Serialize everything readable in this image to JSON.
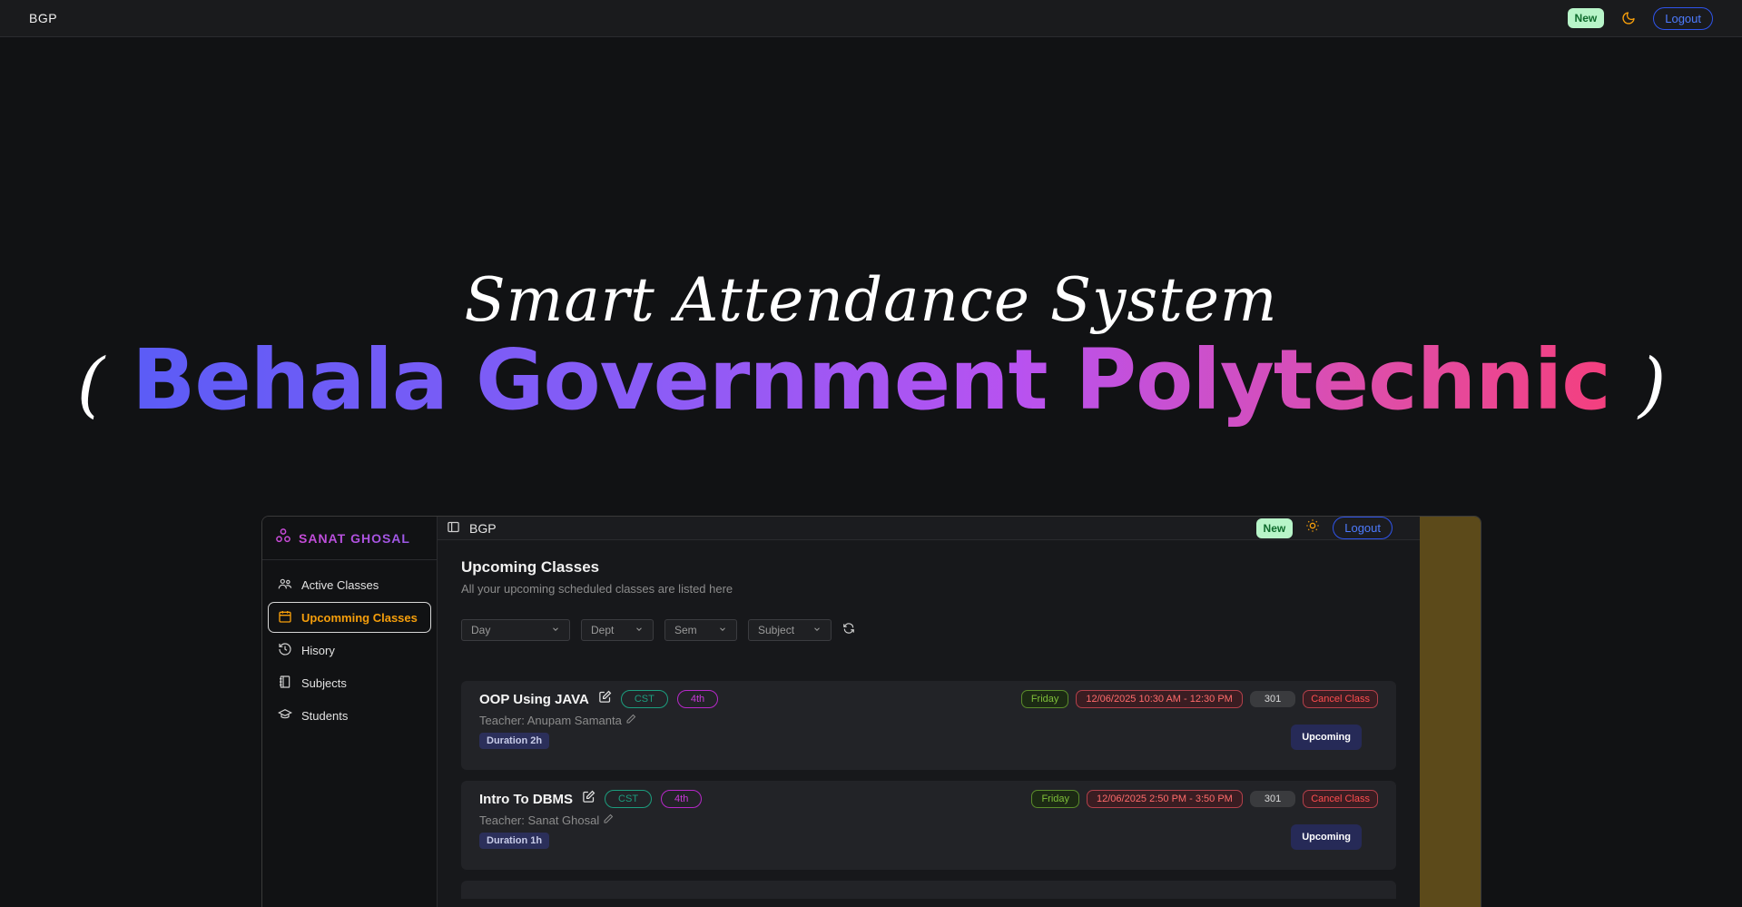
{
  "navbar": {
    "brand": "BGP",
    "new_badge": "New",
    "logout_label": "Logout"
  },
  "hero": {
    "subtitle": "Smart Attendance System",
    "bracket_open": "(",
    "title": "Behala Government Polytechnic",
    "bracket_close": ")"
  },
  "preview": {
    "user_name": "SANAT GHOSAL",
    "sidebar": {
      "items": [
        {
          "label": "Active Classes",
          "icon": "users-icon"
        },
        {
          "label": "Upcomming Classes",
          "icon": "calendar-icon"
        },
        {
          "label": "Hisory",
          "icon": "history-icon"
        },
        {
          "label": "Subjects",
          "icon": "book-icon"
        },
        {
          "label": "Students",
          "icon": "graduation-cap-icon"
        }
      ]
    },
    "topbar": {
      "brand": "BGP",
      "new_badge": "New",
      "logout_label": "Logout"
    },
    "page": {
      "title": "Upcoming Classes",
      "subtitle": "All your upcoming scheduled classes are listed here"
    },
    "filters": {
      "day": "Day",
      "dept": "Dept",
      "sem": "Sem",
      "subject": "Subject"
    },
    "classes": [
      {
        "title": "OOP Using JAVA",
        "dept": "CST",
        "sem": "4th",
        "day": "Friday",
        "datetime": "12/06/2025 10:30 AM - 12:30 PM",
        "room": "301",
        "cancel_label": "Cancel Class",
        "teacher": "Teacher: Anupam Samanta",
        "duration": "Duration 2h",
        "status": "Upcoming"
      },
      {
        "title": "Intro To DBMS",
        "dept": "CST",
        "sem": "4th",
        "day": "Friday",
        "datetime": "12/06/2025 2:50 PM - 3:50 PM",
        "room": "301",
        "cancel_label": "Cancel Class",
        "teacher": "Teacher: Sanat Ghosal",
        "duration": "Duration 1h",
        "status": "Upcoming"
      }
    ]
  },
  "colors": {
    "background": "#111214",
    "accent_orange": "#f59e0b",
    "logout_blue": "#2f54eb",
    "new_badge_bg": "#b8f5c9",
    "gradient_start": "#5b5cf6",
    "gradient_end": "#f43f7e",
    "side_pane": "#5c4a1a"
  }
}
